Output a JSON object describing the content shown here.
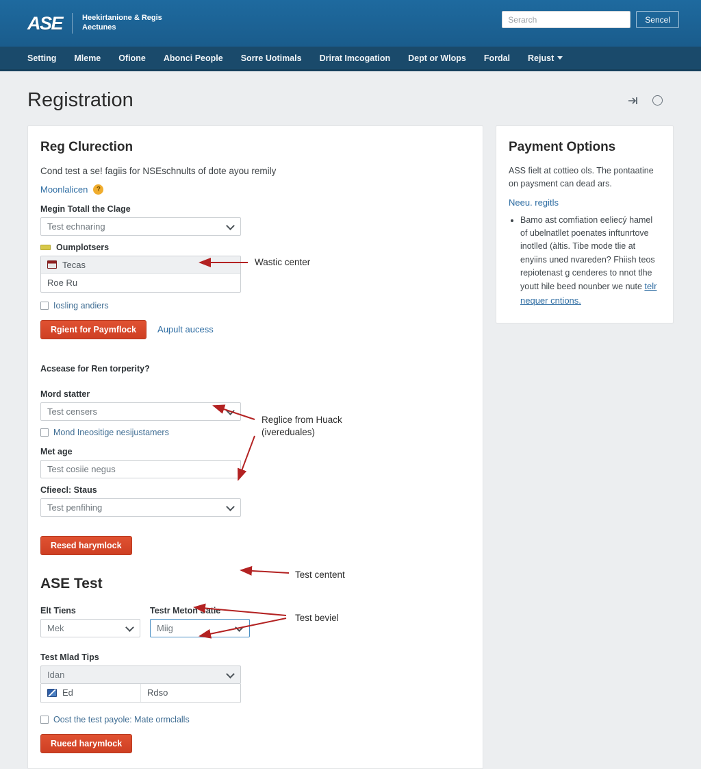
{
  "header": {
    "logo_text": "ASE",
    "logo_subtitle": "Heekirtanione & Regis Aectunes",
    "search_placeholder": "Serarch",
    "search_value": "",
    "search_button": "Sencel"
  },
  "nav": {
    "items": [
      {
        "label": "Setting",
        "has_caret": false
      },
      {
        "label": "Mleme",
        "has_caret": false
      },
      {
        "label": "Ofione",
        "has_caret": false
      },
      {
        "label": "Abonci People",
        "has_caret": false
      },
      {
        "label": "Sorre Uotimals",
        "has_caret": false
      },
      {
        "label": "Drirat Imcogation",
        "has_caret": false
      },
      {
        "label": "Dept or Wlops",
        "has_caret": false
      },
      {
        "label": "Fordal",
        "has_caret": false
      },
      {
        "label": "Rejust",
        "has_caret": true
      }
    ]
  },
  "page": {
    "title": "Registration",
    "icons": [
      "skip-to-end-icon",
      "circle-icon"
    ]
  },
  "main": {
    "section1": {
      "heading": "Reg Clurection",
      "description": "Cond test a se! fagiis for NSEschnults of dote ayou remily",
      "link": "Moonlalicen",
      "badge": "?",
      "field1_label": "Megin Totall the Clage",
      "field1_value": "Test echnaring",
      "group_label": "Oumplotsers",
      "group_rows": [
        {
          "icon": "spreadsheet-icon",
          "text": "Tecas"
        },
        {
          "icon": "",
          "text": "Roe Ru"
        }
      ],
      "checkbox_label": "Iosling andiers",
      "submit_button": "Rgient for Paymflock",
      "secondary_link": "Aupult aucess"
    },
    "section2": {
      "heading": "Acsease for Ren torperity?",
      "field1_label": "Mord statter",
      "field1_value": "Test censers",
      "checkbox_label": "Mond Ineositige nesijustamers",
      "field2_label": "Met age",
      "field2_value": "Test cosiie negus",
      "field3_label": "Cfieecl: Staus",
      "field3_value": "Test penfihing",
      "submit_button": "Resed harymlock"
    },
    "section3": {
      "heading": "ASE Test",
      "field1_label": "Elt Tiens",
      "field1_value": "Mek",
      "field2_label": "Testr Meton Satie",
      "field2_value": "Miig",
      "field3_label": "Test Mlad Tips",
      "field3_value": "Idan",
      "grid_row": {
        "icon": "chart-icon",
        "col1": "Ed",
        "col2": "Rdso"
      },
      "checkbox_label": "Oost the test payole: Mate ormclalls",
      "submit_button": "Rueed harymlock"
    }
  },
  "sidebar": {
    "heading": "Payment Options",
    "paragraph": "ASS fielt at cottieo ols. The pontaatine on paysment can dead ars.",
    "link": "Neeu. regitls",
    "bullet": "Bamo ast comfiation eeliecý hamel of ubelnatllet poenates inftunrtove inotlled (àltis. Tibe mode tlie at enyiins uned nvareden? Fhiish teos repiotenast g cenderes to nnot tlhe youtt hile beed nounber we nute",
    "bullet_link": "telr nequer cntions."
  },
  "annotations": [
    {
      "name": "wastic-center",
      "text": "Wastic center"
    },
    {
      "name": "reglice-from-huack",
      "text": "Reglice from Huack\n(ivereduales)"
    },
    {
      "name": "test-centent",
      "text": "Test centent"
    },
    {
      "name": "test-beviel",
      "text": "Test beviel"
    }
  ],
  "colors": {
    "topbar": "#1c6396",
    "navbar": "#1a4a6b",
    "primary_button": "#d9482b",
    "link": "#2d6ca2",
    "annotation": "#b32222",
    "badge": "#f0ad2e"
  }
}
